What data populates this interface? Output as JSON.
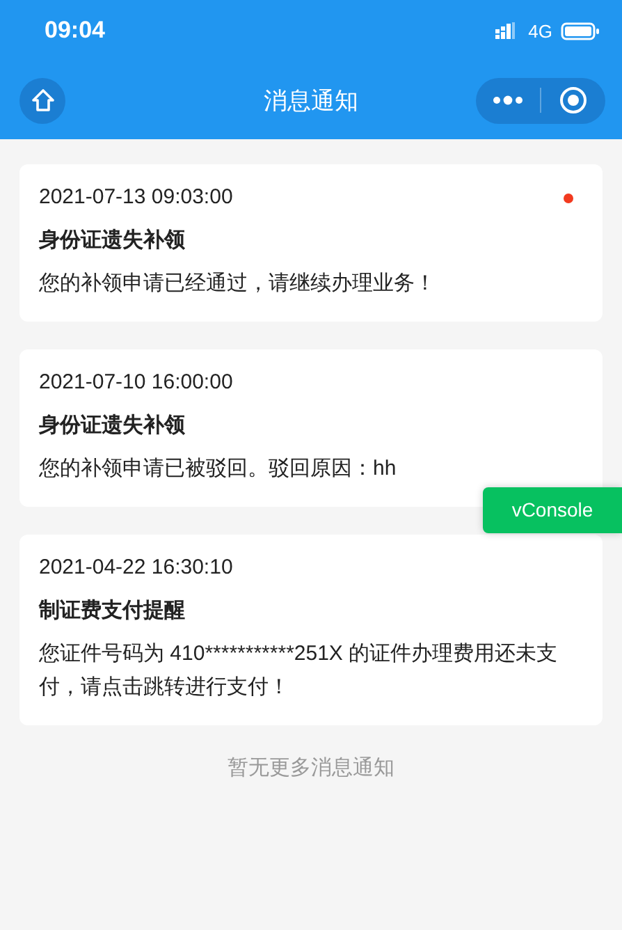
{
  "status_bar": {
    "time": "09:04",
    "network": "4G"
  },
  "nav": {
    "title": "消息通知"
  },
  "messages": [
    {
      "date": "2021-07-13 09:03:00",
      "title": "身份证遗失补领",
      "body": "您的补领申请已经通过，请继续办理业务！",
      "unread": true
    },
    {
      "date": "2021-07-10 16:00:00",
      "title": "身份证遗失补领",
      "body": "您的补领申请已被驳回。驳回原因：hh",
      "unread": false
    },
    {
      "date": "2021-04-22 16:30:10",
      "title": "制证费支付提醒",
      "body": "您证件号码为 410***********251X 的证件办理费用还未支付，请点击跳转进行支付！",
      "unread": false
    }
  ],
  "footer": "暂无更多消息通知",
  "floating_button": {
    "label": "vConsole"
  }
}
